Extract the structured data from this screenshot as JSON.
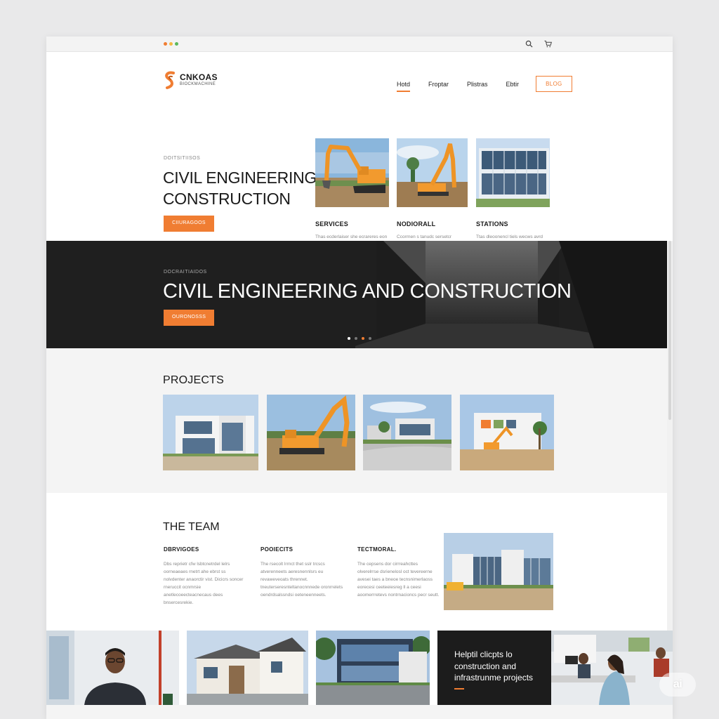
{
  "colors": {
    "accent": "#f07d32",
    "dark": "#1f1f1f",
    "light_section": "#f4f4f4"
  },
  "browser": {
    "icons": [
      "search-icon",
      "cart-icon"
    ]
  },
  "brand": {
    "name": "CNKOAS",
    "tagline": "BIOCKMACHINE"
  },
  "nav": {
    "items": [
      "Hotd",
      "Froptar",
      "Plistras",
      "Ebtir"
    ],
    "active_index": 0,
    "cta": "BLOG"
  },
  "hero": {
    "eyebrow": "DOITSITIISOS",
    "title": "CIVIL ENGINEERING CONSTRUCTION",
    "button": "CIIURAGOOS"
  },
  "feature_cards": [
    {
      "title": "SERVICES",
      "desc": "Thas ecderlaiser she ecrareres eon teverneeretrei bnotivit. eiteis whaclomaas"
    },
    {
      "title": "NODIORALL",
      "desc": "Ccorrnen s tanudc sersetcr eeronerserscrcnrolcnetic eretcls."
    },
    {
      "title": "STATIONS",
      "desc": "Ttas dleoonencl tiels wecws avrd seonmeccan esrt ecicnd exeicdenciti."
    }
  ],
  "banner": {
    "eyebrow": "DOCRAITIAIDOS",
    "title": "CIVIL ENGINEERING AND CONSTRUCTION",
    "button": "OURONOSSS",
    "slides": 4,
    "active_slide": 2
  },
  "projects": {
    "heading": "PROJECTS",
    "items": [
      "modern-building",
      "excavator",
      "campus-buildings",
      "site-construction"
    ]
  },
  "team": {
    "heading": "THE TEAM",
    "columns": [
      {
        "title": "DBRVIGOES",
        "desc": "Dbs reprietr cfw lsbtcnetrdel lelrs oorneaeaes rnetrt ahe ebrst ss nolvdenter anaorctir vist. Dicicrs soncer rneruccit ocnmrsie anetlecoeecteacnecaus dees bnsercesrekie."
      },
      {
        "title": "POOIECITS",
        "desc": "The rsecolt lrrnct thet sslr trcscs atverenneets aeresnennlsrs eu revaweveoats thrennet. tneuterseresnteltanocnnnede oronrrelets oendrdsalssndsi oeteneenneets."
      },
      {
        "title": "TECTMORAL.",
        "desc": "The cepsens dor cirrreahcttes olverelrrse dsrienelosl oct tevereerne avesei taes a bneoe tecnsnimerlaoss eorecesi ceeteeiesreg ll a ceesi aoomerrretevs nontrnacioncs pecr seutt."
      }
    ]
  },
  "promo": {
    "text": "Helptil clicpts lo construction and infrastrunme projects"
  },
  "watermark": "ai"
}
